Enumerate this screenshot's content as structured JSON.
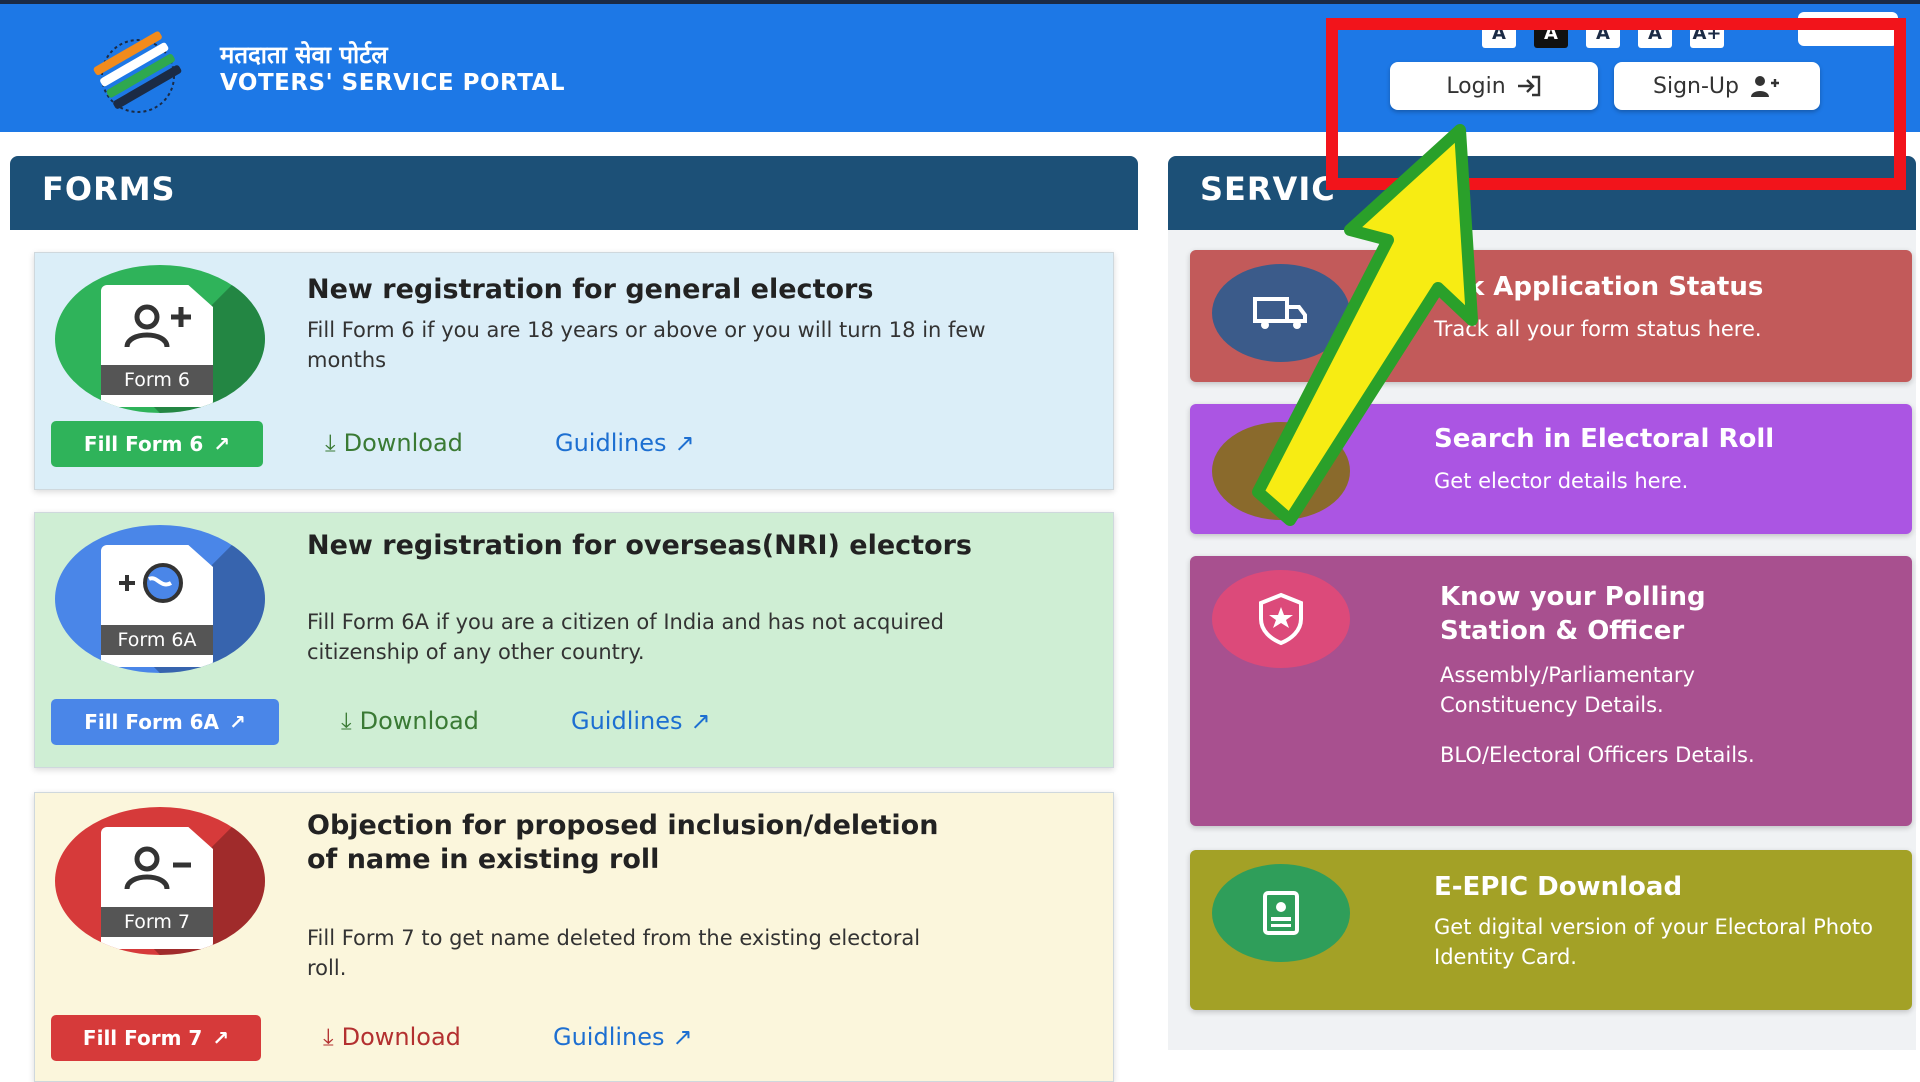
{
  "header": {
    "title_hi": "मतदाता सेवा पोर्टल",
    "title_en": "VOTERS' SERVICE PORTAL",
    "font_sizer": [
      "A",
      "A",
      "A",
      "A",
      "A+"
    ],
    "login_label": "Login",
    "signup_label": "Sign-Up"
  },
  "forms": {
    "heading": "FORMS",
    "cards": [
      {
        "icon_label": "Form 6",
        "title": "New registration for general electors",
        "description": "Fill Form 6 if you are 18 years or above or you will turn 18 in few months",
        "fill_label": "Fill Form 6",
        "download_label": "Download",
        "guidelines_label": "Guidlines"
      },
      {
        "icon_label": "Form 6A",
        "title": "New registration for overseas(NRI) electors",
        "description": "Fill Form 6A if you are a citizen of India and has not acquired citizenship of any other country.",
        "fill_label": "Fill Form 6A",
        "download_label": "Download",
        "guidelines_label": "Guidlines"
      },
      {
        "icon_label": "Form 7",
        "title": "Objection for proposed inclusion/deletion of name in existing roll",
        "description": "Fill Form 7 to get name deleted from the existing electoral roll.",
        "fill_label": "Fill Form 7",
        "download_label": "Download",
        "guidelines_label": "Guidlines"
      }
    ]
  },
  "services": {
    "heading": "SERVIC",
    "cards": [
      {
        "title": "ack Application Status",
        "description": "Track all your form status here."
      },
      {
        "title": "Search in Electoral Roll",
        "description": "Get elector details here."
      },
      {
        "title": "Know your Polling Station & Officer",
        "description": "Assembly/Parliamentary Constituency Details.",
        "description2": "BLO/Electoral Officers Details."
      },
      {
        "title": "E-EPIC Download",
        "description": "Get digital version of your Electoral Photo Identity Card."
      }
    ]
  },
  "colors": {
    "header_bg": "#1d78e6",
    "panel_bar": "#1c5077",
    "form6_accent": "#2fb35a",
    "form6a_accent": "#4a86e8",
    "form7_accent": "#d63a3a",
    "annotation_red": "#f2141b",
    "annotation_arrow": "#f7ec13"
  }
}
